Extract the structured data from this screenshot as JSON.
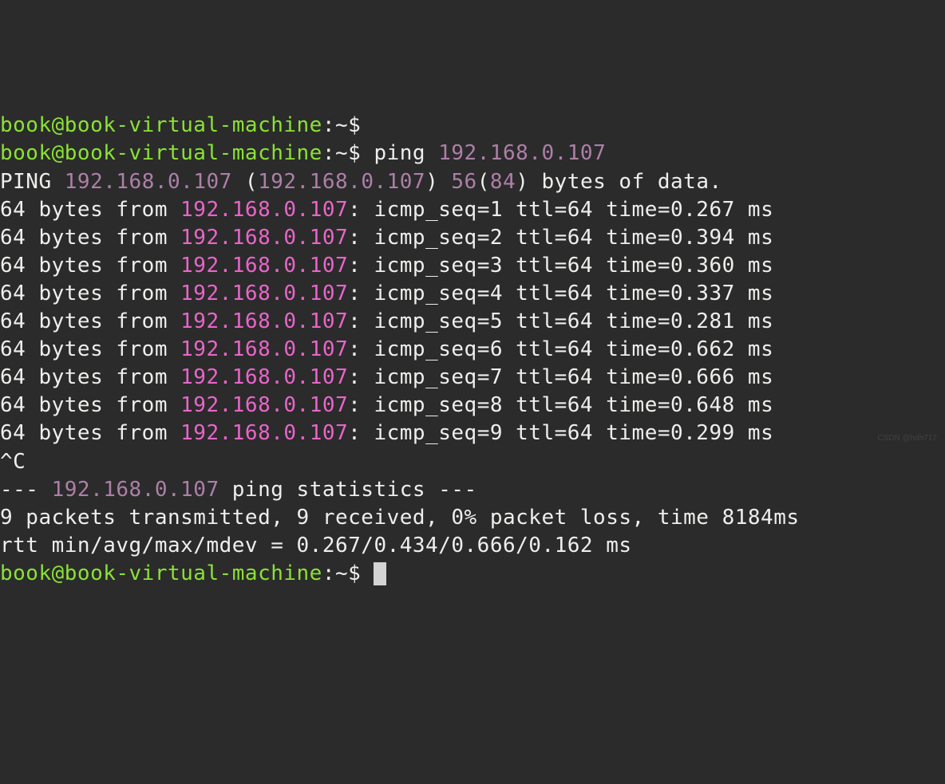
{
  "prompt": {
    "user_host": "book@book-virtual-machine",
    "path": ":~",
    "symbol": "$"
  },
  "commands": {
    "empty": "",
    "ping_cmd": "ping ",
    "ping_target": "192.168.0.107"
  },
  "ping_header": {
    "label": "PING ",
    "ip": "192.168.0.107",
    "paren_open": " (",
    "paren_ip": "192.168.0.107",
    "paren_close": ") ",
    "size": "56",
    "paren_size_open": "(",
    "size2": "84",
    "paren_size_close": ")",
    "suffix": " bytes of data."
  },
  "replies": [
    {
      "prefix": "64 bytes from ",
      "ip": "192.168.0.107",
      "sep": ": ",
      "tail": "icmp_seq=1 ttl=64 time=0.267 ms"
    },
    {
      "prefix": "64 bytes from ",
      "ip": "192.168.0.107",
      "sep": ": ",
      "tail": "icmp_seq=2 ttl=64 time=0.394 ms"
    },
    {
      "prefix": "64 bytes from ",
      "ip": "192.168.0.107",
      "sep": ": ",
      "tail": "icmp_seq=3 ttl=64 time=0.360 ms"
    },
    {
      "prefix": "64 bytes from ",
      "ip": "192.168.0.107",
      "sep": ": ",
      "tail": "icmp_seq=4 ttl=64 time=0.337 ms"
    },
    {
      "prefix": "64 bytes from ",
      "ip": "192.168.0.107",
      "sep": ": ",
      "tail": "icmp_seq=5 ttl=64 time=0.281 ms"
    },
    {
      "prefix": "64 bytes from ",
      "ip": "192.168.0.107",
      "sep": ": ",
      "tail": "icmp_seq=6 ttl=64 time=0.662 ms"
    },
    {
      "prefix": "64 bytes from ",
      "ip": "192.168.0.107",
      "sep": ": ",
      "tail": "icmp_seq=7 ttl=64 time=0.666 ms"
    },
    {
      "prefix": "64 bytes from ",
      "ip": "192.168.0.107",
      "sep": ": ",
      "tail": "icmp_seq=8 ttl=64 time=0.648 ms"
    },
    {
      "prefix": "64 bytes from ",
      "ip": "192.168.0.107",
      "sep": ": ",
      "tail": "icmp_seq=9 ttl=64 time=0.299 ms"
    }
  ],
  "interrupt": "^C",
  "stats_header": {
    "prefix": "--- ",
    "ip": "192.168.0.107",
    "suffix": " ping statistics ---"
  },
  "stats_line1": "9 packets transmitted, 9 received, 0% packet loss, time 8184ms",
  "stats_line2": "rtt min/avg/max/mdev = 0.267/0.434/0.666/0.162 ms",
  "watermark": "CSDN @hdh717"
}
